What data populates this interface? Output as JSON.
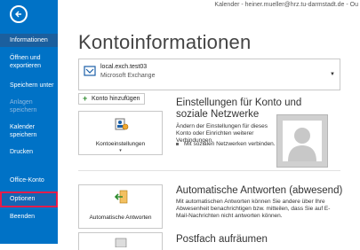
{
  "window": {
    "title": "Kalender - heiner.mueller@hrz.tu-darmstadt.de - Ou"
  },
  "sidebar": {
    "items": [
      {
        "label": "Informationen"
      },
      {
        "label": "Öffnen und exportieren"
      },
      {
        "label": "Speichern unter"
      },
      {
        "label": "Anlagen speichern"
      },
      {
        "label": "Kalender speichern"
      },
      {
        "label": "Drucken"
      },
      {
        "label": "Office-Konto"
      },
      {
        "label": "Optionen"
      },
      {
        "label": "Beenden"
      }
    ]
  },
  "main": {
    "title": "Kontoinformationen",
    "account": {
      "name": "local.exch.test03",
      "type": "Microsoft Exchange"
    },
    "add_account_label": "Konto hinzufügen",
    "sections": {
      "settings": {
        "button_label": "Kontoeinstellungen",
        "title": "Einstellungen für Konto und soziale Netzwerke",
        "desc": "Ändern der Einstellungen für dieses Konto oder Einrichten weiterer Verbindungen.",
        "bullet": "Mit sozialen Netzwerken verbinden."
      },
      "auto_reply": {
        "button_label": "Automatische Antworten",
        "title": "Automatische Antworten (abwesend)",
        "desc": "Mit automatischen Antworten können Sie andere über Ihre Abwesenheit benachrichtigen bzw. mitteilen, dass Sie auf E-Mail-Nachrichten nicht antworten können."
      },
      "cleanup": {
        "title": "Postfach aufräumen"
      }
    }
  }
}
